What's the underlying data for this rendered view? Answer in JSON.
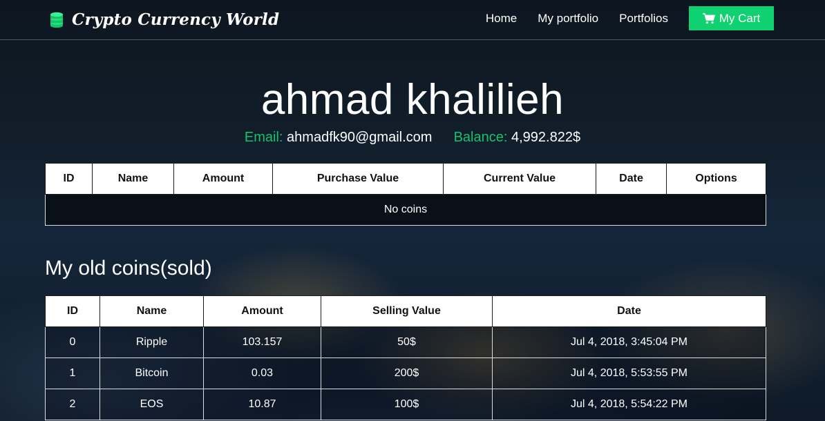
{
  "navbar": {
    "brand": "Crypto Currency World",
    "links": [
      "Home",
      "My portfolio",
      "Portfolios"
    ],
    "cart_label": "My Cart",
    "cart_color": "#0fd172"
  },
  "profile": {
    "name": "ahmad khalilieh",
    "email_label": "Email:",
    "email": "ahmadfk90@gmail.com",
    "balance_label": "Balance:",
    "balance": "4,992.822$",
    "accent_color": "#17c36a"
  },
  "coins_table": {
    "headers": [
      "ID",
      "Name",
      "Amount",
      "Purchase Value",
      "Current Value",
      "Date",
      "Options"
    ],
    "empty_text": "No coins"
  },
  "sold_section": {
    "title": "My old coins(sold)",
    "headers": [
      "ID",
      "Name",
      "Amount",
      "Selling Value",
      "Date"
    ],
    "rows": [
      [
        "0",
        "Ripple",
        "103.157",
        "50$",
        "Jul 4, 2018, 3:45:04 PM"
      ],
      [
        "1",
        "Bitcoin",
        "0.03",
        "200$",
        "Jul 4, 2018, 5:53:55 PM"
      ],
      [
        "2",
        "EOS",
        "10.87",
        "100$",
        "Jul 4, 2018, 5:54:22 PM"
      ]
    ]
  },
  "icons": {
    "brand": "coin-stack-icon",
    "cart": "shopping-cart-icon"
  }
}
